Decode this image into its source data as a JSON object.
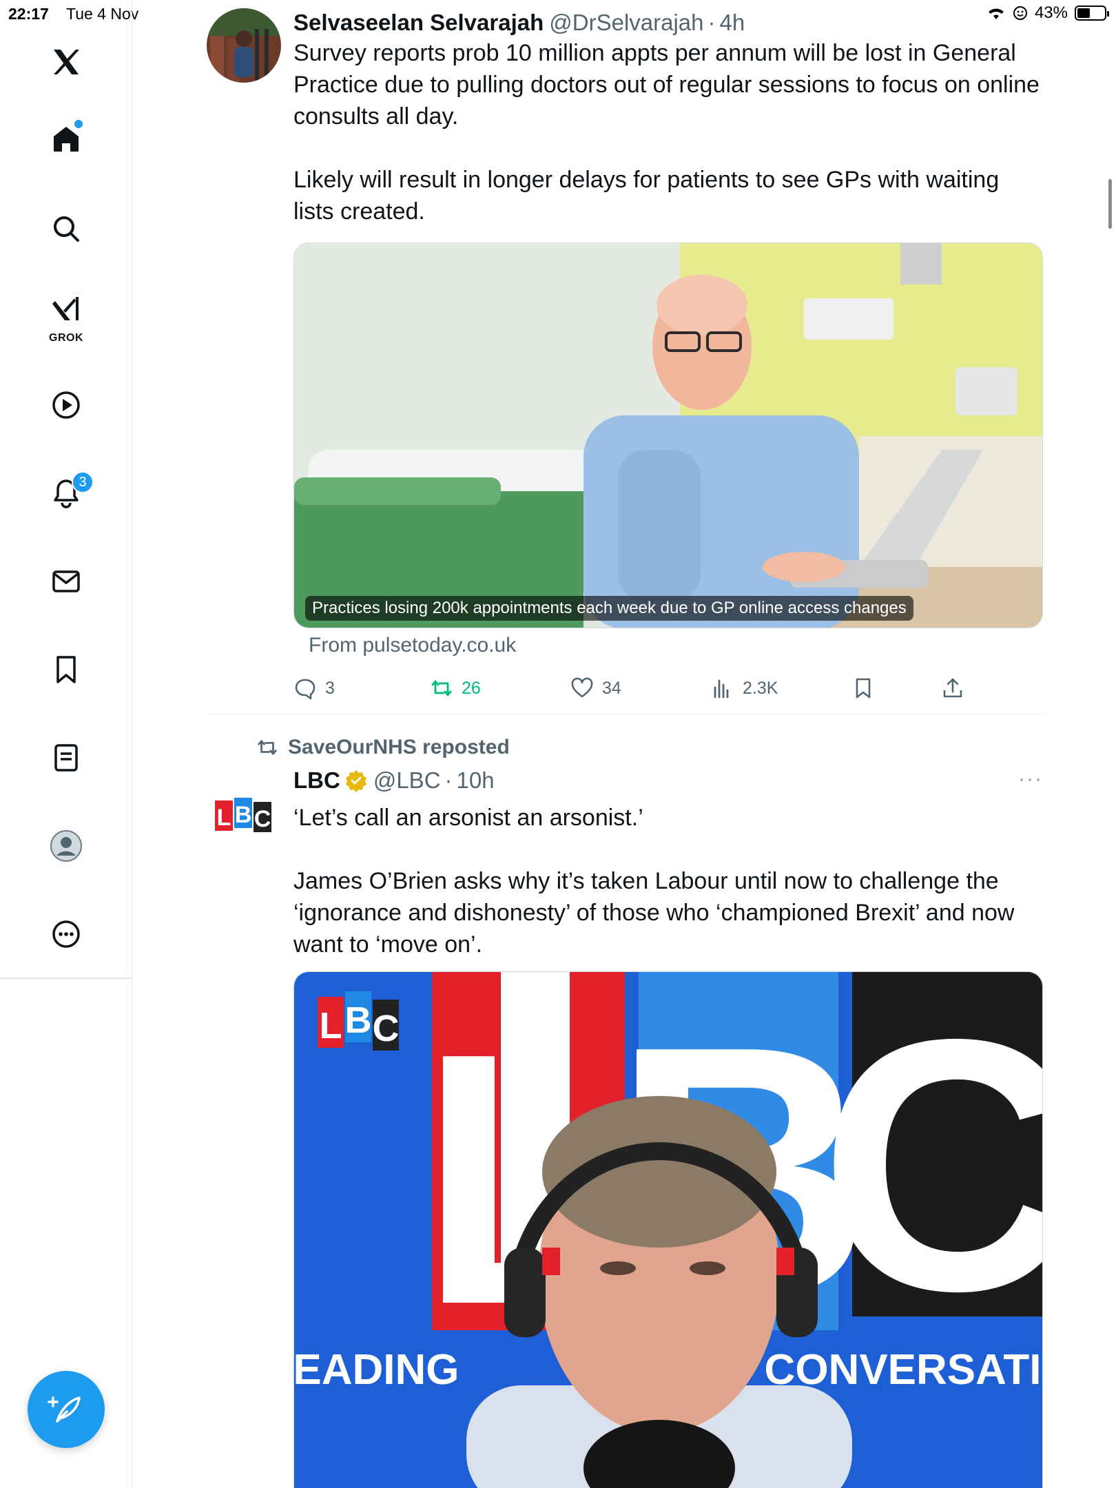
{
  "status_bar": {
    "time": "22:17",
    "date": "Tue 4 Nov",
    "battery": "43%"
  },
  "sidebar": {
    "grok_label": "GROK",
    "notifications_count": "3",
    "items": [
      "x-logo",
      "home",
      "search",
      "grok",
      "video",
      "notifications",
      "messages",
      "bookmarks",
      "lists",
      "profile",
      "more"
    ]
  },
  "tweets": [
    {
      "name": "Selvaseelan Selvarajah",
      "handle": "@DrSelvarajah",
      "time": "4h",
      "text_1": "Survey reports prob 10 million appts per annum will be lost in General Practice due to pulling doctors out of regular sessions to focus on online consults all day.",
      "text_2": "Likely will result in longer delays for patients to see GPs with waiting lists created.",
      "card_caption": "Practices losing 200k appointments each week due to GP online access changes",
      "card_source": "From pulsetoday.co.uk",
      "replies": "3",
      "reposts": "26",
      "likes": "34",
      "views": "2.3K"
    },
    {
      "repost_by": "SaveOurNHS reposted",
      "name": "LBC",
      "handle": "@LBC",
      "time": "10h",
      "avatar_text": "LBC",
      "text_1": "‘Let’s call an arsonist an arsonist.’",
      "text_2": "James O’Brien asks why it’s taken Labour until now to challenge the ‘ignorance and dishonesty’ of those who ‘championed Brexit’ and now want to ‘move on’.",
      "video_logo": "LBC",
      "video_big_letters": [
        "L",
        "B",
        "C"
      ],
      "video_strap": "LEADING BRITAIN'S CONVERSATION"
    }
  ],
  "colors": {
    "accent": "#1d9bf0",
    "repost_green": "#00ba7c",
    "secondary_text": "#536471",
    "lbc_red": "#e2212a",
    "lbc_blue": "#1e88e5"
  }
}
